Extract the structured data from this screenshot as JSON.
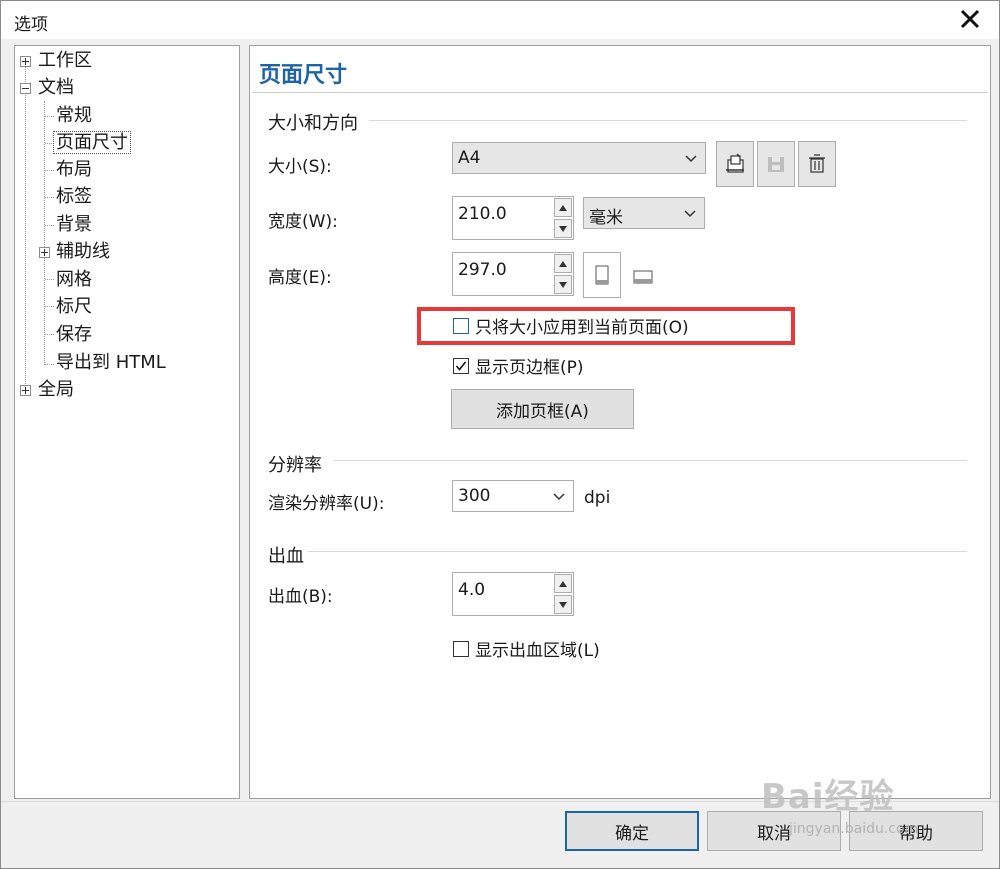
{
  "window": {
    "title": "选项"
  },
  "tree": {
    "items": [
      {
        "label": "工作区"
      },
      {
        "label": "文档"
      },
      {
        "label": "常规"
      },
      {
        "label": "页面尺寸"
      },
      {
        "label": "布局"
      },
      {
        "label": "标签"
      },
      {
        "label": "背景"
      },
      {
        "label": "辅助线"
      },
      {
        "label": "网格"
      },
      {
        "label": "标尺"
      },
      {
        "label": "保存"
      },
      {
        "label": "导出到 HTML"
      },
      {
        "label": "全局"
      }
    ]
  },
  "panel": {
    "title": "页面尺寸",
    "size_group": {
      "title": "大小和方向",
      "size_label": "大小(S):",
      "size_value": "A4",
      "width_label": "宽度(W):",
      "width_value": "210.0",
      "unit_value": "毫米",
      "height_label": "高度(E):",
      "height_value": "297.0",
      "apply_current_label": "只将大小应用到当前页面(O)",
      "apply_current_checked": false,
      "show_border_label": "显示页边框(P)",
      "show_border_checked": true,
      "add_frame_label": "添加页框(A)"
    },
    "resolution_group": {
      "title": "分辨率",
      "render_label": "渲染分辨率(U):",
      "render_value": "300",
      "unit": "dpi"
    },
    "bleed_group": {
      "title": "出血",
      "bleed_label": "出血(B):",
      "bleed_value": "4.0",
      "show_bleed_label": "显示出血区域(L)",
      "show_bleed_checked": false
    }
  },
  "buttons": {
    "ok": "确定",
    "cancel": "取消",
    "help": "帮助"
  },
  "watermark": {
    "main": "Bai经验",
    "sub": "jingyan.baidu.com"
  }
}
